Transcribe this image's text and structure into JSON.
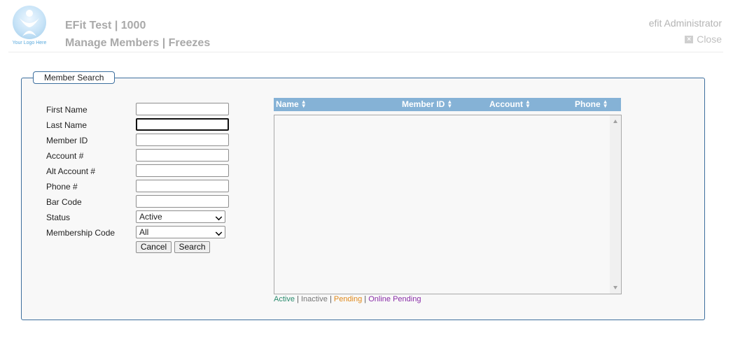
{
  "header": {
    "logo_text": "Your Logo Here",
    "app_title": "EFit Test | 1000",
    "page_title": "Manage Members | Freezes",
    "user": "efit Administrator",
    "close_label": "Close"
  },
  "search": {
    "legend": "Member Search",
    "fields": [
      {
        "label": "First Name",
        "value": ""
      },
      {
        "label": "Last Name",
        "value": ""
      },
      {
        "label": "Member ID",
        "value": ""
      },
      {
        "label": "Account #",
        "value": ""
      },
      {
        "label": "Alt Account #",
        "value": ""
      },
      {
        "label": "Phone #",
        "value": ""
      },
      {
        "label": "Bar Code",
        "value": ""
      }
    ],
    "status": {
      "label": "Status",
      "value": "Active"
    },
    "membership_code": {
      "label": "Membership Code",
      "value": "All"
    },
    "cancel_label": "Cancel",
    "search_label": "Search"
  },
  "grid": {
    "columns": [
      "Name",
      "Member ID",
      "Account",
      "Phone"
    ],
    "sort_icon": "▲▼"
  },
  "status_legend": {
    "active": "Active",
    "inactive": "Inactive",
    "pending": "Pending",
    "online_pending": "Online Pending",
    "separator": "|",
    "colors": {
      "active": "#2a8c6e",
      "inactive": "#777777",
      "pending": "#e08a1c",
      "online_pending": "#8a2ea8"
    }
  },
  "colors": {
    "grid_header": "#85b2d6",
    "fieldset_border": "#3d6f9e"
  }
}
